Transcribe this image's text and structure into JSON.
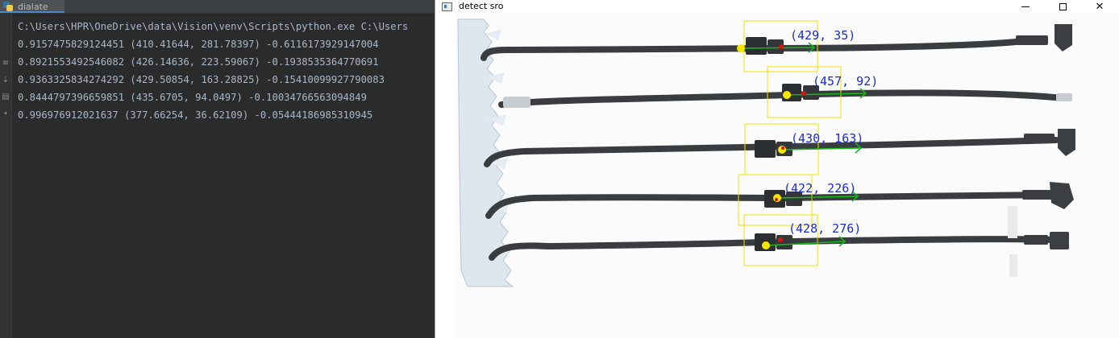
{
  "ide": {
    "tab_label": "dialate",
    "console_lines": [
      "C:\\Users\\HPR\\OneDrive\\data\\Vision\\venv\\Scripts\\python.exe C:\\Users",
      "0.9157475829124451 (410.41644, 281.78397) -0.6116173929147004",
      "0.8921553492546082 (426.14636, 223.59067) -0.1938535364770691",
      "0.9363325834274292 (429.50854, 163.28825) -0.15410099927790083",
      "0.8444797396659851 (435.6705, 94.0497) -0.10034766563094849",
      "0.996976912021637 (377.66254, 36.62109) -0.05444186985310945"
    ]
  },
  "cv_window": {
    "title": "detect sro",
    "minimize_icon": "minimize-icon",
    "maximize_icon": "maximize-icon",
    "close_icon": "close-icon",
    "close_glyph": "✕",
    "detections": [
      {
        "label": "(429, 35)"
      },
      {
        "label": "(457, 92)"
      },
      {
        "label": "(430, 163)"
      },
      {
        "label": "(422, 226)"
      },
      {
        "label": "(428, 276)"
      }
    ]
  },
  "colors": {
    "bbox": "#f0e000",
    "label_text": "#1a2bd0",
    "arrow": "#15b81a",
    "center_dot": "#f7e600",
    "key_dot": "#d81010",
    "hose": "#3a3d3f"
  }
}
